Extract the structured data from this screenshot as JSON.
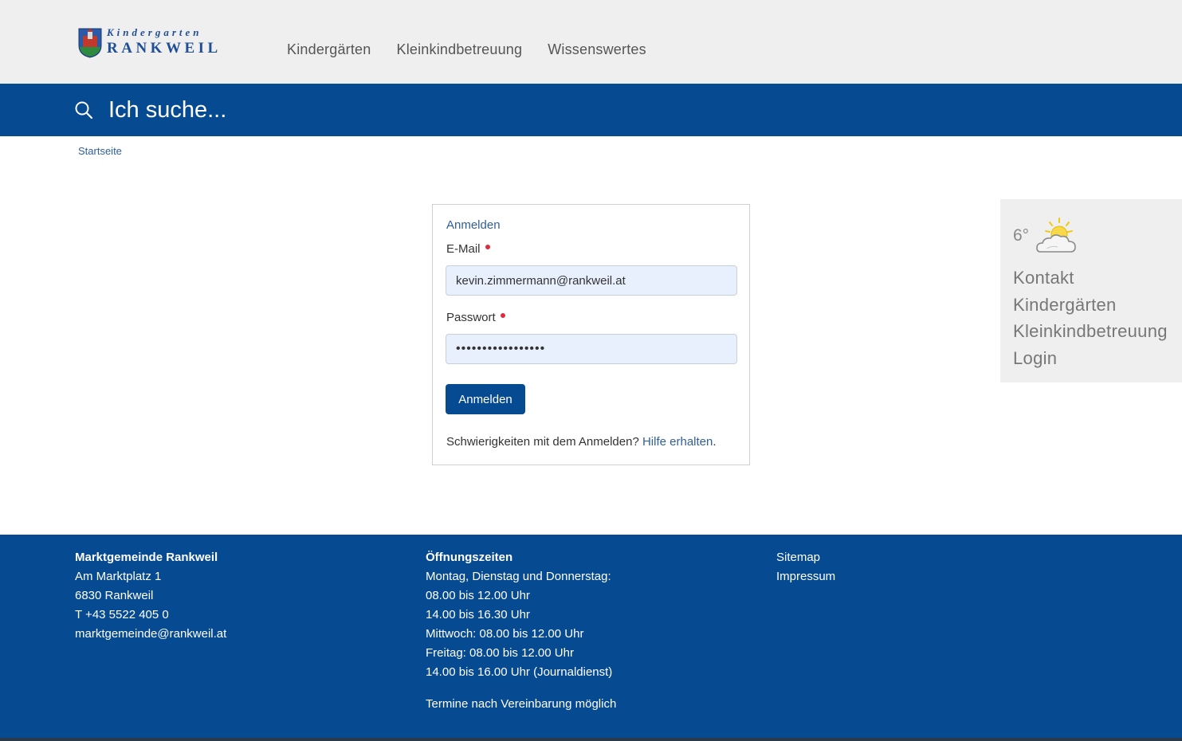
{
  "header": {
    "logo": {
      "line1": "Kindergarten",
      "line2": "RANKWEIL"
    },
    "nav": [
      {
        "label": "Kindergärten"
      },
      {
        "label": "Kleinkindbetreuung"
      },
      {
        "label": "Wissenswertes"
      }
    ]
  },
  "search": {
    "placeholder": "Ich suche..."
  },
  "breadcrumb": {
    "home": "Startseite"
  },
  "login": {
    "title": "Anmelden",
    "email_label": "E-Mail",
    "email_value": "kevin.zimmermann@rankweil.at",
    "password_label": "Passwort",
    "password_value": "•••••••••••••••••",
    "submit_label": "Anmelden",
    "help_text": "Schwierigkeiten mit dem Anmelden? ",
    "help_link": "Hilfe erhalten",
    "help_suffix": "."
  },
  "sidebar": {
    "temperature": "6°",
    "weather_icon": "partly-cloudy-icon",
    "links": [
      {
        "label": "Kontakt"
      },
      {
        "label": "Kindergärten"
      },
      {
        "label": "Kleinkindbetreuung"
      },
      {
        "label": "Login"
      }
    ]
  },
  "footer": {
    "address": {
      "title": "Marktgemeinde Rankweil",
      "street": "Am Marktplatz 1",
      "city": "6830 Rankweil",
      "phone": "T +43 5522 405 0",
      "email": "marktgemeinde@rankweil.at"
    },
    "hours": {
      "title": "Öffnungszeiten",
      "lines": [
        "Montag, Dienstag und Donnerstag:",
        "08.00 bis 12.00 Uhr",
        "14.00 bis 16.30 Uhr",
        "Mittwoch: 08.00 bis 12.00 Uhr",
        "Freitag: 08.00 bis 12.00 Uhr",
        "14.00 bis 16.00 Uhr (Journaldienst)"
      ],
      "note": "Termine nach Vereinbarung möglich"
    },
    "links": [
      {
        "label": "Sitemap"
      },
      {
        "label": "Impressum"
      }
    ]
  },
  "colors": {
    "brand_blue": "#064a91",
    "link_blue": "#2f5f9a",
    "required_red": "#e02a3d",
    "header_gray": "#efefef"
  }
}
